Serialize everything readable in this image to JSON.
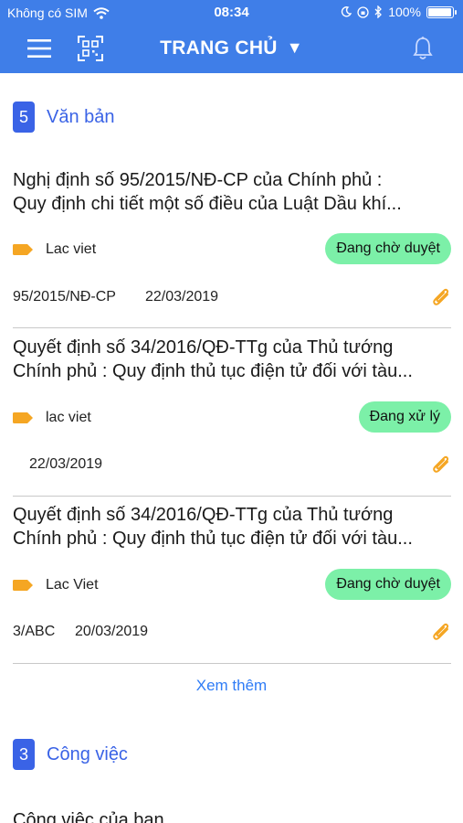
{
  "status_bar": {
    "carrier": "Không có SIM",
    "time": "08:34",
    "battery": "100%"
  },
  "nav": {
    "title": "TRANG CHỦ",
    "caret": "▼"
  },
  "documents_section": {
    "count": "5",
    "title": "Văn bản",
    "items": [
      {
        "title_line1": "Nghị định số 95/2015/NĐ-CP của Chính phủ :",
        "title_line2": "Quy định chi tiết một số điều của Luật Dầu khí...",
        "tag": "Lac viet",
        "status": "Đang chờ duyệt",
        "number": "95/2015/NĐ-CP",
        "date": "22/03/2019"
      },
      {
        "title_line1": "Quyết định số 34/2016/QĐ-TTg của Thủ tướng",
        "title_line2": "Chính phủ : Quy định thủ tục điện tử đối với tàu...",
        "tag": "lac viet",
        "status": "Đang xử lý",
        "number": "",
        "date": "22/03/2019"
      },
      {
        "title_line1": "Quyết định số 34/2016/QĐ-TTg của Thủ tướng",
        "title_line2": "Chính phủ : Quy định thủ tục điện tử đối với tàu...",
        "tag": "Lac Viet",
        "status": "Đang chờ duyệt",
        "number": "3/ABC",
        "date": "20/03/2019"
      }
    ],
    "see_more": "Xem thêm"
  },
  "tasks_section": {
    "count": "3",
    "title": "Công việc",
    "first_item_partial": "Công việc của bạn"
  },
  "colors": {
    "header": "#3f7ee8",
    "accent": "#3a63e6",
    "status_pill": "#7cf0a8",
    "tag_icon": "#f5a623",
    "link": "#2f7cf6"
  },
  "icons": [
    "menu-icon",
    "qr-scan-icon",
    "bell-icon",
    "wifi-icon",
    "tag-icon",
    "paperclip-icon"
  ]
}
